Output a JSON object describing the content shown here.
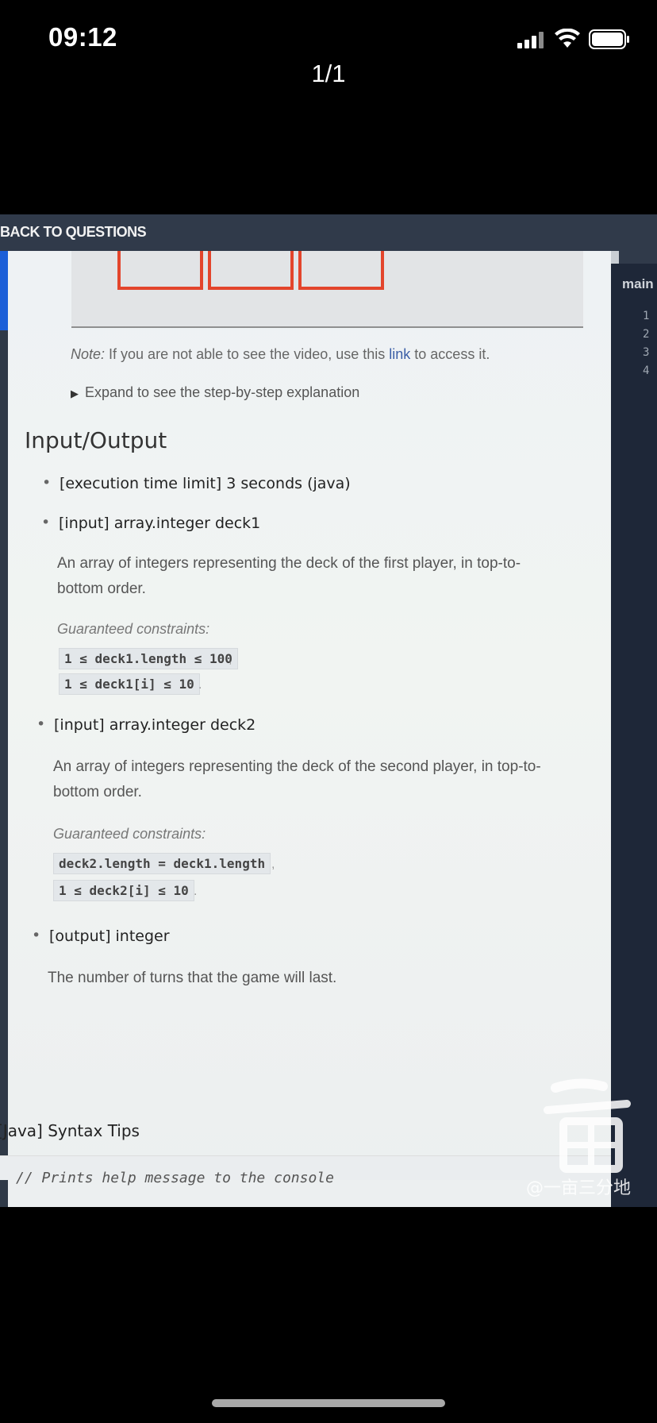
{
  "status_bar": {
    "time": "09:12",
    "page_counter": "1/1"
  },
  "photo": {
    "back_link": "BACK TO QUESTIONS",
    "note": {
      "prefix": "Note:",
      "text": " If you are not able to see the video, use this ",
      "link": "link",
      "suffix": " to access it."
    },
    "expand": "Expand to see the step-by-step explanation",
    "section_title": "Input/Output",
    "items": [
      {
        "label": "[execution time limit] 3 seconds (java)"
      },
      {
        "label": "[input] array.integer deck1",
        "desc_1": "An array of integers representing the deck of the first player, in top-to-",
        "desc_2": "bottom order.",
        "constraints_label": "Guaranteed constraints:",
        "code_1": "1 ≤ deck1.length ≤ 100",
        "code_2": "1 ≤ deck1[i] ≤ 10"
      },
      {
        "label": "[input] array.integer deck2",
        "desc_1": "An array of integers representing the deck of the second player, in top-to-",
        "desc_2": "bottom order.",
        "constraints_label": "Guaranteed constraints:",
        "code_1": "deck2.length = deck1.length",
        "code_2": "1 ≤ deck2[i] ≤ 10"
      },
      {
        "label": "[output] integer",
        "desc_1": "The number of turns that the game will last."
      }
    ],
    "syntax_tips": "[Java] Syntax Tips",
    "code_comment": "// Prints help message to the console",
    "right_panel": {
      "title": "main",
      "line_numbers": [
        "1",
        "2",
        "3",
        "4"
      ]
    },
    "watermark_text": "@一亩三分地"
  },
  "colors": {
    "accent_red": "#e3452c",
    "top_bar": "#303a4a",
    "right_panel": "#1e2738",
    "link_blue": "#3b5ea6"
  }
}
